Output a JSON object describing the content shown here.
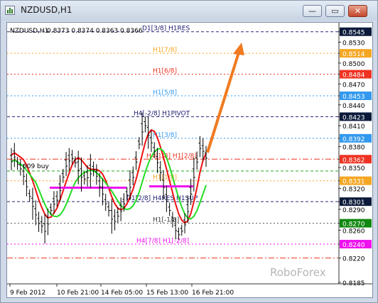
{
  "window": {
    "title": "NZDUSD,H1",
    "minimize_label": "—",
    "maximize_label": "▭",
    "close_label": "✕"
  },
  "chart_info": {
    "symbol": "NZDUSD,H1",
    "ohlc": "0.8373 0.8374 0.8363 0.8366"
  },
  "colors": {
    "price_bars": "#000000",
    "green_line": "#22dd22",
    "red_line": "#ee1111",
    "magenta_line": "#ee11ee",
    "arrow": "#f07a20",
    "background": "#ffffff"
  },
  "watermark": "RoboForex",
  "annotation_text": "609 buy",
  "chart_data": {
    "type": "candlestick-bars",
    "title": "NZDUSD,H1",
    "y_ticks": [
      "0.8545",
      "0.8530",
      "0.8514",
      "0.8500",
      "0.8484",
      "0.8470",
      "0.8453",
      "0.8440",
      "0.8423",
      "0.8410",
      "0.8392",
      "0.8380",
      "0.8362",
      "0.8350",
      "0.8331",
      "0.8320",
      "0.8301",
      "0.8290",
      "0.8270",
      "0.8260",
      "0.8240",
      "0.8220",
      "0.8185"
    ],
    "highlighted_ticks": [
      {
        "value": "0.8545",
        "style": "dark"
      },
      {
        "value": "0.8514",
        "style": "orange"
      },
      {
        "value": "0.8484",
        "style": "red"
      },
      {
        "value": "0.8453",
        "style": "blue"
      },
      {
        "value": "0.8423",
        "style": "dark"
      },
      {
        "value": "0.8392",
        "style": "blue"
      },
      {
        "value": "0.8362",
        "style": "red"
      },
      {
        "value": "0.8331",
        "style": "orange"
      },
      {
        "value": "0.8301",
        "style": "dark"
      },
      {
        "value": "0.8270",
        "style": "green"
      },
      {
        "value": "0.8240",
        "style": "magenta"
      }
    ],
    "x_ticks": [
      "9 Feb 2012",
      "10 Feb 21:00",
      "14 Feb 05:00",
      "15 Feb 13:00",
      "16 Feb 21:00"
    ],
    "level_labels": [
      {
        "text": "D1[3/8] H1RES",
        "color": "#1a1a6e",
        "price": 0.8545
      },
      {
        "text": "H1[7/8]",
        "color": "#f5a623",
        "price": 0.8514
      },
      {
        "text": "H1[6/8]",
        "color": "#ee3322",
        "price": 0.8484
      },
      {
        "text": "H1[5/8]",
        "color": "#3399ee",
        "price": 0.8453
      },
      {
        "text": "H4[-2/8] H1PIVOT",
        "color": "#1a1a6e",
        "price": 0.8423
      },
      {
        "text": "H1[3/8]",
        "color": "#3399ee",
        "price": 0.8392
      },
      {
        "text": "H4[1/8] H1[2/8]",
        "color": "#ee3322",
        "price": 0.8362
      },
      {
        "text": "H1[1/8]",
        "color": "#f5a623",
        "price": 0.8331
      },
      {
        "text": "D1[2/8] H4RES H1SUP",
        "color": "#1a1a6e",
        "price": 0.8301
      },
      {
        "text": "H1[-1/8]",
        "color": "#333333",
        "price": 0.827
      },
      {
        "text": "H4[7/8] H1[-2/8]",
        "color": "#ee11ee",
        "price": 0.824
      }
    ],
    "levels": [
      {
        "price": 0.8545,
        "color": "#2a2a7a",
        "style": "dash"
      },
      {
        "price": 0.8514,
        "color": "#f5a623",
        "style": "dot"
      },
      {
        "price": 0.8484,
        "color": "#ee3322",
        "style": "dot"
      },
      {
        "price": 0.8453,
        "color": "#3399ee",
        "style": "dot"
      },
      {
        "price": 0.8423,
        "color": "#2a2a7a",
        "style": "dash"
      },
      {
        "price": 0.8392,
        "color": "#3399ee",
        "style": "dot"
      },
      {
        "price": 0.8362,
        "color": "#ee3322",
        "style": "dashdot"
      },
      {
        "price": 0.8345,
        "color": "#22aa22",
        "style": "dash"
      },
      {
        "price": 0.8331,
        "color": "#f5a623",
        "style": "dot"
      },
      {
        "price": 0.8301,
        "color": "#2a2a7a",
        "style": "dash"
      },
      {
        "price": 0.827,
        "color": "#555555",
        "style": "dot"
      },
      {
        "price": 0.824,
        "color": "#ee11ee",
        "style": "dot"
      },
      {
        "price": 0.822,
        "color": "#ee3322",
        "style": "dashdot"
      }
    ],
    "ylim": [
      0.8185,
      0.856
    ],
    "series": [
      {
        "name": "price",
        "values": [
          0.8362,
          0.8368,
          0.8356,
          0.835,
          0.834,
          0.8325,
          0.831,
          0.8298,
          0.8285,
          0.8272,
          0.8268,
          0.8262,
          0.8272,
          0.829,
          0.83,
          0.8305,
          0.832,
          0.8338,
          0.8355,
          0.8362,
          0.8365,
          0.8358,
          0.835,
          0.834,
          0.8335,
          0.8338,
          0.8345,
          0.8348,
          0.834,
          0.8325,
          0.8315,
          0.83,
          0.829,
          0.828,
          0.8275,
          0.8282,
          0.829,
          0.83,
          0.8312,
          0.8325,
          0.8338,
          0.836,
          0.8385,
          0.8405,
          0.8412,
          0.84,
          0.8388,
          0.8375,
          0.836,
          0.8345,
          0.8325,
          0.8305,
          0.829,
          0.8275,
          0.8262,
          0.8255,
          0.826,
          0.827,
          0.829,
          0.8315,
          0.834,
          0.836,
          0.838,
          0.8376,
          0.8366
        ]
      }
    ]
  }
}
